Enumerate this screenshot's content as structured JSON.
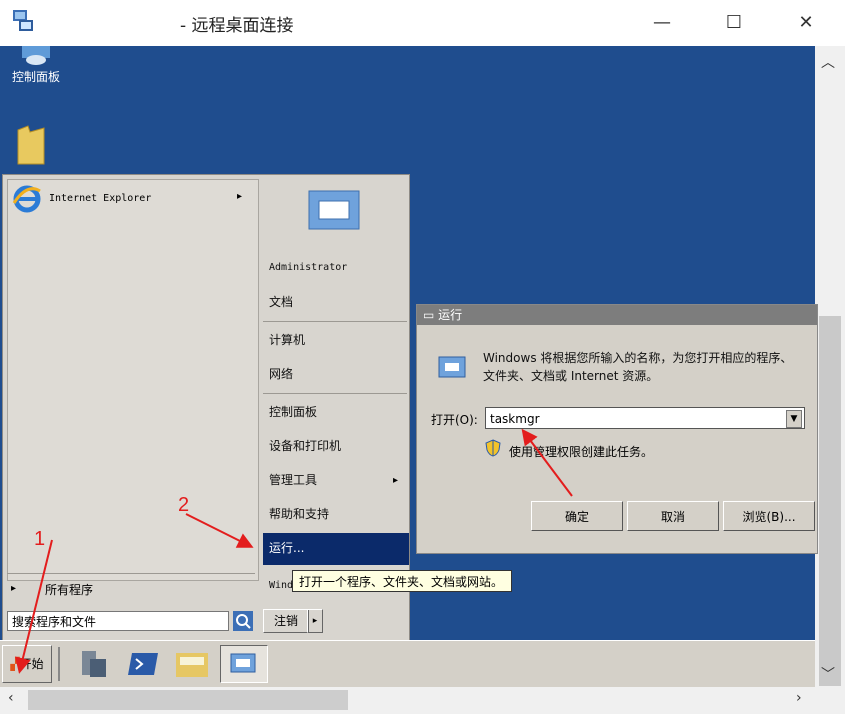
{
  "window": {
    "title": "- 远程桌面连接",
    "minimize": "—",
    "maximize": "☐",
    "close": "✕"
  },
  "desktop": {
    "control_panel_label": "控制面板"
  },
  "start_menu": {
    "ie_label": "Internet Explorer",
    "right_items": [
      "Administrator",
      "文档",
      "计算机",
      "网络",
      "控制面板",
      "设备和打印机",
      "管理工具",
      "帮助和支持",
      "运行..."
    ],
    "all_programs": "所有程序",
    "search_placeholder": "搜索程序和文件",
    "logoff": "注销",
    "windows_security_partial": "Wind",
    "tooltip": "打开一个程序、文件夹、文档或网站。"
  },
  "taskbar": {
    "start_label": "开始"
  },
  "run_dialog": {
    "title": "运行",
    "description": "Windows 将根据您所输入的名称，为您打开相应的程序、文件夹、文档或 Internet 资源。",
    "open_label": "打开(O):",
    "input_value": "taskmgr",
    "admin_text": "使用管理权限创建此任务。",
    "ok": "确定",
    "cancel": "取消",
    "browse": "浏览(B)..."
  },
  "annotations": {
    "step1": "1",
    "step2": "2"
  },
  "colors": {
    "desktop": "#1f4d8e",
    "highlight": "#0b2a6a",
    "annotation": "#e31d1d"
  }
}
